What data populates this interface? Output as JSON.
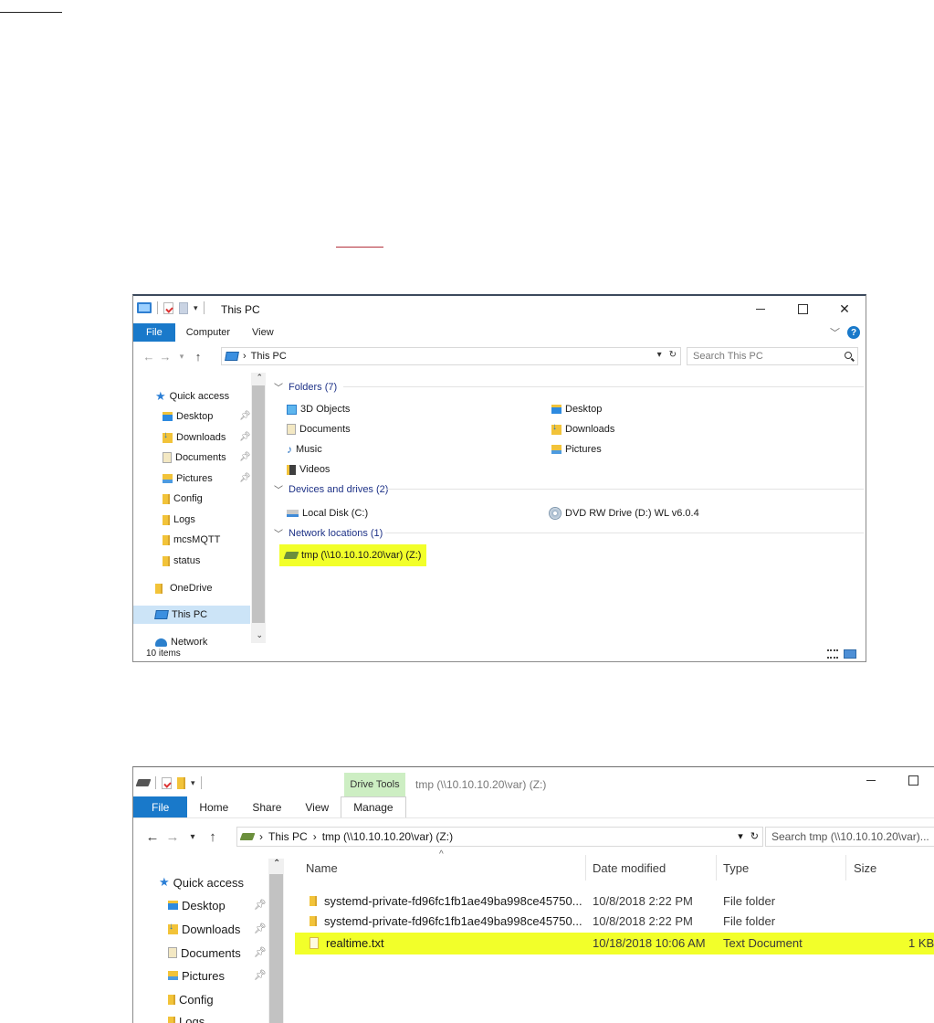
{
  "window1": {
    "title": "This PC",
    "ribbon_tabs": [
      "File",
      "Computer",
      "View"
    ],
    "address": "This PC",
    "search_placeholder": "Search This PC",
    "nav": {
      "quick_access": "Quick access",
      "items": [
        "Desktop",
        "Downloads",
        "Documents",
        "Pictures",
        "Config",
        "Logs",
        "mcsMQTT",
        "status"
      ],
      "onedrive": "OneDrive",
      "this_pc": "This PC",
      "network": "Network"
    },
    "groups": {
      "folders": "Folders (7)",
      "devices": "Devices and drives (2)",
      "network": "Network locations (1)"
    },
    "folders": [
      "3D Objects",
      "Desktop",
      "Documents",
      "Downloads",
      "Music",
      "Pictures",
      "Videos"
    ],
    "drives": [
      "Local Disk (C:)",
      "DVD RW Drive (D:) WL v6.0.4"
    ],
    "network_locations": [
      "tmp (\\\\10.10.10.20\\var) (Z:)"
    ],
    "status": "10 items",
    "highlight_color": "#f2ff2a"
  },
  "window2": {
    "context_tab": "Drive Tools",
    "title": "tmp (\\\\10.10.10.20\\var) (Z:)",
    "ribbon_tabs": [
      "File",
      "Home",
      "Share",
      "View",
      "Manage"
    ],
    "breadcrumb": [
      "This PC",
      "tmp (\\\\10.10.10.20\\var) (Z:)"
    ],
    "search_placeholder": "Search tmp (\\\\10.10.10.20\\var)...",
    "nav": {
      "quick_access": "Quick access",
      "items": [
        "Desktop",
        "Downloads",
        "Documents",
        "Pictures",
        "Config",
        "Logs"
      ]
    },
    "columns": [
      "Name",
      "Date modified",
      "Type",
      "Size"
    ],
    "rows": [
      {
        "name": "systemd-private-fd96fc1fb1ae49ba998ce45750...",
        "date": "10/8/2018 2:22 PM",
        "type": "File folder",
        "size": ""
      },
      {
        "name": "systemd-private-fd96fc1fb1ae49ba998ce45750...",
        "date": "10/8/2018 2:22 PM",
        "type": "File folder",
        "size": ""
      },
      {
        "name": "realtime.txt",
        "date": "10/18/2018 10:06 AM",
        "type": "Text Document",
        "size": "1 KB"
      }
    ]
  }
}
